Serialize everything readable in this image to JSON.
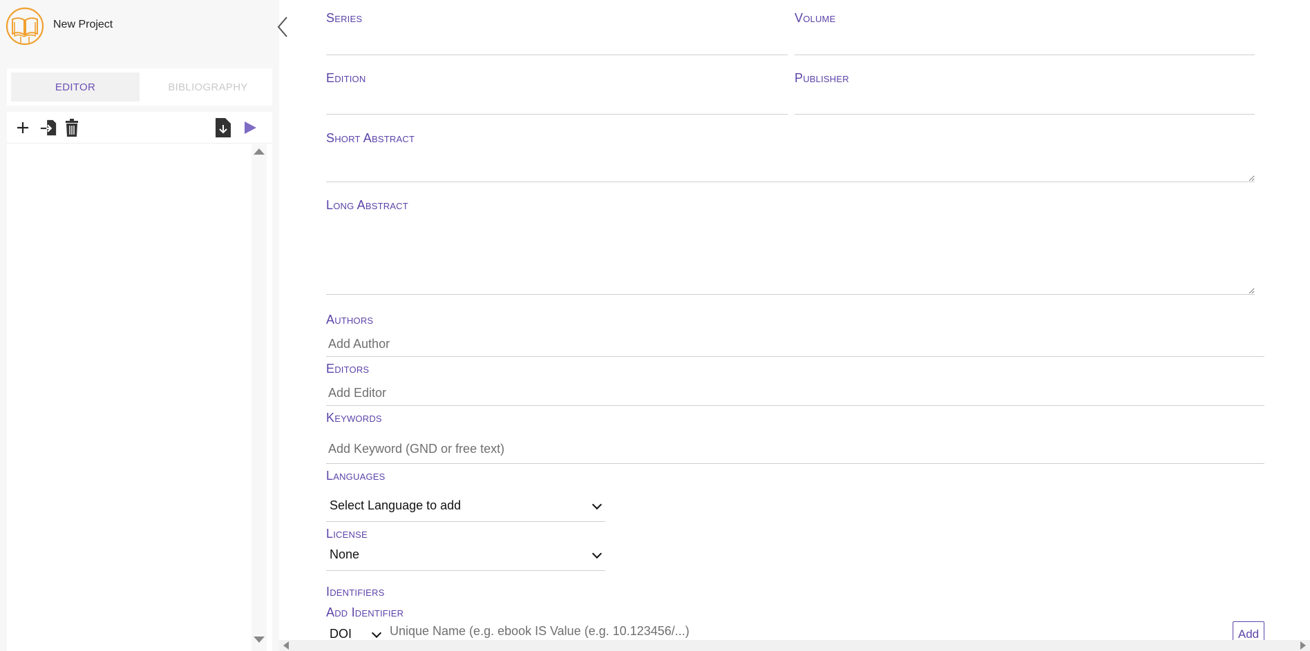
{
  "project": {
    "name": "New Project"
  },
  "tabs": {
    "editor": "EDITOR",
    "bibliography": "BIBLIOGRAPHY"
  },
  "toolbar": {
    "icons": [
      "plus-icon",
      "import-icon",
      "trash-icon",
      "download-file-icon",
      "play-icon"
    ]
  },
  "form": {
    "series": {
      "label": "Series",
      "value": ""
    },
    "volume": {
      "label": "Volume",
      "value": ""
    },
    "edition": {
      "label": "Edition",
      "value": ""
    },
    "publisher": {
      "label": "Publisher",
      "value": ""
    },
    "short_abstract": {
      "label": "Short Abstract",
      "value": ""
    },
    "long_abstract": {
      "label": "Long Abstract",
      "value": ""
    },
    "authors": {
      "label": "Authors",
      "placeholder": "Add Author"
    },
    "editors": {
      "label": "Editors",
      "placeholder": "Add Editor"
    },
    "keywords": {
      "label": "Keywords",
      "placeholder": "Add Keyword (GND or free text)"
    },
    "languages": {
      "label": "Languages",
      "selected": "Select Language to add"
    },
    "license": {
      "label": "License",
      "selected": "None"
    },
    "identifiers": {
      "label": "Identifiers",
      "add_label": "Add Identifier",
      "type_selected": "DOI",
      "name_placeholder": "Unique Name (e.g. ebook ISBN)",
      "value_placeholder": "Value (e.g. 10.123456/...)",
      "add_button": "Add"
    }
  },
  "colors": {
    "accent": "#5b43a8",
    "logo": "#f0a030",
    "play": "#7e6bc4"
  }
}
